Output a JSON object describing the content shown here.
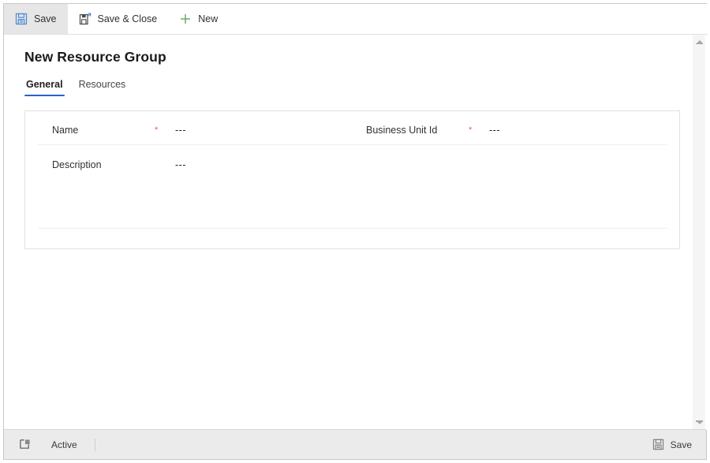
{
  "command_bar": {
    "buttons": [
      {
        "label": "Save",
        "icon": "save-disk-icon",
        "state": "active"
      },
      {
        "label": "Save & Close",
        "icon": "save-and-close-icon",
        "state": "default"
      },
      {
        "label": "New",
        "icon": "plus-icon",
        "state": "default"
      }
    ]
  },
  "page": {
    "title": "New Resource Group"
  },
  "tabs": [
    {
      "label": "General",
      "selected": true
    },
    {
      "label": "Resources",
      "selected": false
    }
  ],
  "form": {
    "fields": [
      {
        "label": "Name",
        "required": true,
        "required_marker": "*",
        "value": "---"
      },
      {
        "label": "Business Unit Id",
        "required": true,
        "required_marker": "*",
        "value": "---"
      },
      {
        "label": "Description",
        "required": false,
        "required_marker": "",
        "value": "---"
      }
    ]
  },
  "status_bar": {
    "popout_icon": "open-in-new-window-icon",
    "state_label": "Active",
    "save_label": "Save",
    "save_icon": "save-disk-icon"
  },
  "scrollbar": {
    "up_icon": "scroll-up-arrow-icon",
    "down_icon": "scroll-down-arrow-icon"
  },
  "colors": {
    "accent": "#2564cf",
    "required_star": "#e8604c",
    "new_icon_green": "#5aab61",
    "save_icon_blue": "#4c8ad6",
    "border": "#e1e1e1",
    "status_bg": "#ebebeb"
  }
}
